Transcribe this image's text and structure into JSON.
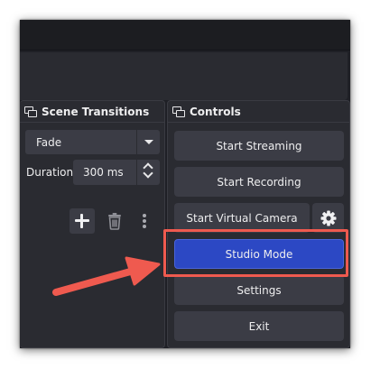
{
  "scene_transitions": {
    "title": "Scene Transitions",
    "transition_select": "Fade",
    "duration_label": "Duration",
    "duration_value": "300 ms",
    "add_icon": "plus-icon",
    "remove_icon": "trash-icon",
    "more_icon": "more-vertical-icon"
  },
  "controls": {
    "title": "Controls",
    "start_streaming": "Start Streaming",
    "start_recording": "Start Recording",
    "start_virtual_camera": "Start Virtual Camera",
    "virtual_camera_settings_icon": "gear-icon",
    "studio_mode": "Studio Mode",
    "settings": "Settings",
    "exit": "Exit"
  },
  "annotation": {
    "highlight_color": "#ef5a4f",
    "highlighted_control": "Studio Mode"
  },
  "colors": {
    "panel_bg": "#2a2b31",
    "button_bg": "#3b3c45",
    "accent_active": "#2c48c4"
  }
}
